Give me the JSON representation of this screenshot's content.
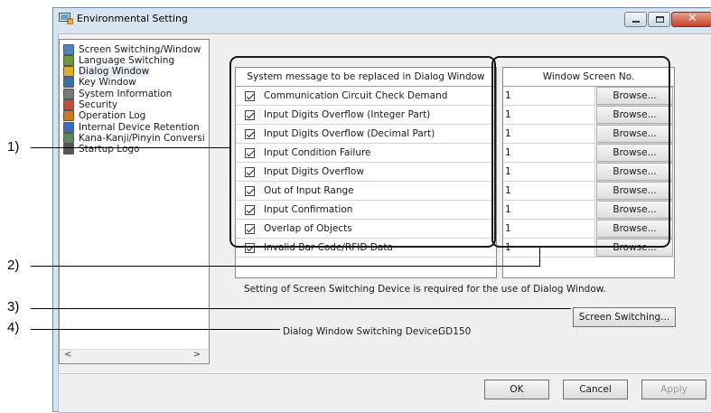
{
  "callouts": [
    "1)",
    "2)",
    "3)",
    "4)"
  ],
  "window": {
    "title": "Environmental Setting",
    "icon": "environmental-setting-icon"
  },
  "tree": {
    "items": [
      {
        "label": "Screen Switching/Window",
        "icon": "screen-switching-icon",
        "selected": false
      },
      {
        "label": "Language Switching",
        "icon": "language-switching-icon",
        "selected": false
      },
      {
        "label": "Dialog Window",
        "icon": "dialog-window-icon",
        "selected": true
      },
      {
        "label": "Key Window",
        "icon": "key-window-icon",
        "selected": false
      },
      {
        "label": "System Information",
        "icon": "system-information-icon",
        "selected": false
      },
      {
        "label": "Security",
        "icon": "security-icon",
        "selected": false
      },
      {
        "label": "Operation Log",
        "icon": "operation-log-icon",
        "selected": false
      },
      {
        "label": "Internal Device Retention",
        "icon": "internal-device-retention-icon",
        "selected": false
      },
      {
        "label": "Kana-Kanji/Pinyin Conversi",
        "icon": "kana-kanji-conversion-icon",
        "selected": false
      },
      {
        "label": "Startup Logo",
        "icon": "startup-logo-icon",
        "selected": false
      }
    ],
    "scroll_left": "<",
    "scroll_right": ">"
  },
  "grid": {
    "col_message": "System message to be replaced in Dialog Window",
    "col_screen_no": "Window Screen No.",
    "browse_label": "Browse...",
    "rows": [
      {
        "message": "Communication Circuit Check Demand",
        "screen_no": "1",
        "checked": true
      },
      {
        "message": "Input Digits Overflow (Integer Part)",
        "screen_no": "1",
        "checked": true
      },
      {
        "message": "Input Digits Overflow (Decimal Part)",
        "screen_no": "1",
        "checked": true
      },
      {
        "message": "Input Condition Failure",
        "screen_no": "1",
        "checked": true
      },
      {
        "message": "Input Digits Overflow",
        "screen_no": "1",
        "checked": true
      },
      {
        "message": "Out of Input Range",
        "screen_no": "1",
        "checked": true
      },
      {
        "message": "Input Confirmation",
        "screen_no": "1",
        "checked": true
      },
      {
        "message": "Overlap of Objects",
        "screen_no": "1",
        "checked": true
      },
      {
        "message": "Invalid Bar Code/RFID Data",
        "screen_no": "1",
        "checked": true
      }
    ]
  },
  "note": "Setting of Screen Switching Device is required for the use of Dialog Window.",
  "screen_switching_button": "Screen Switching...",
  "device": {
    "label": "Dialog Window Switching Device:",
    "value": "GD150"
  },
  "footer": {
    "ok": "OK",
    "cancel": "Cancel",
    "apply": "Apply"
  }
}
